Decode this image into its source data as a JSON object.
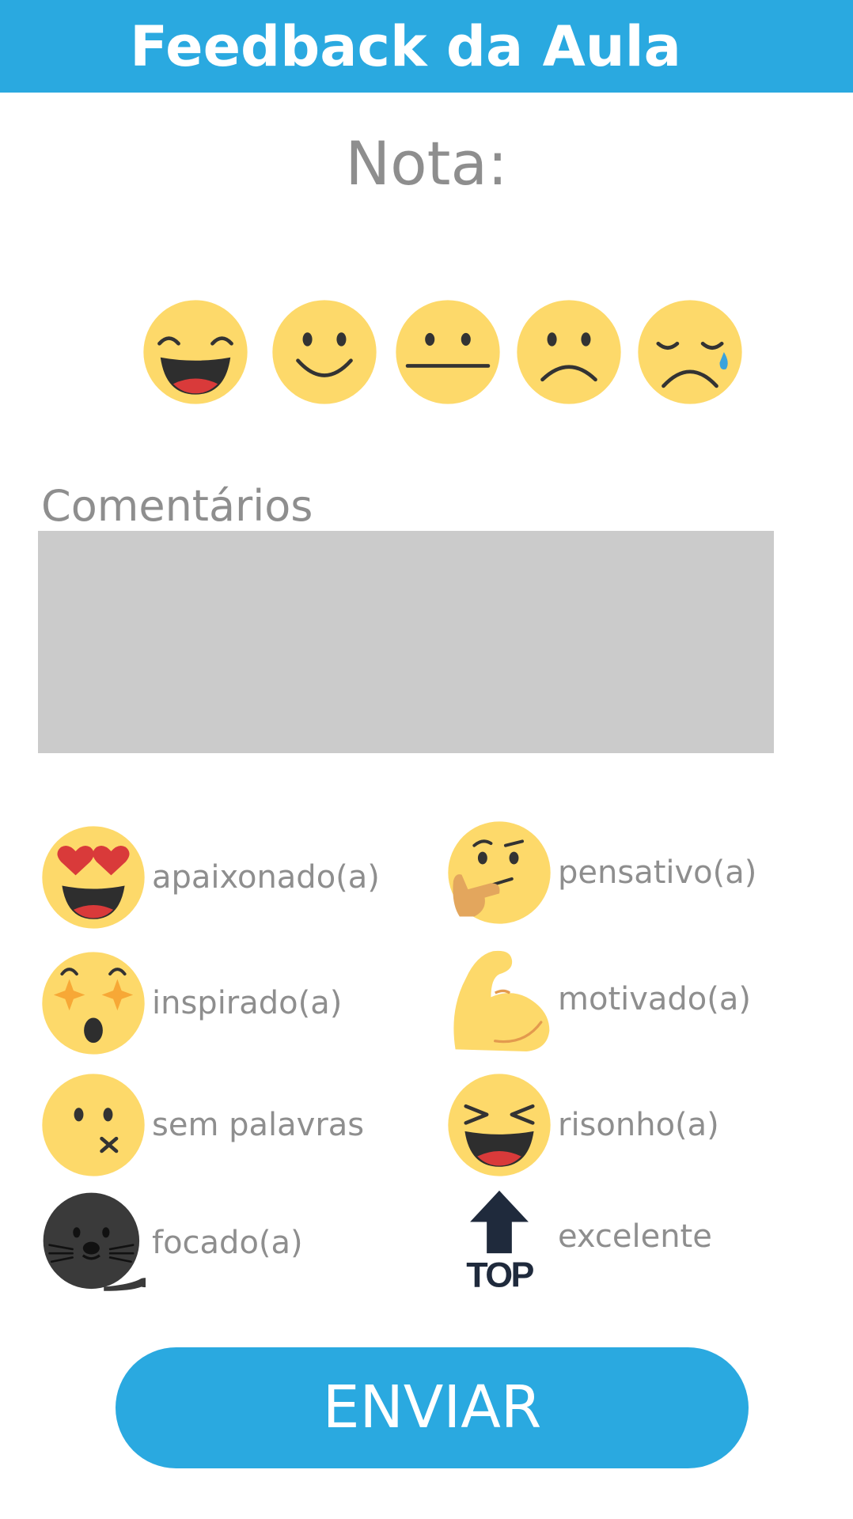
{
  "header": {
    "title": "Feedback da Aula"
  },
  "rating": {
    "label": "Nota:",
    "faces": [
      {
        "icon": "laughing-face-icon"
      },
      {
        "icon": "smiling-face-icon"
      },
      {
        "icon": "neutral-face-icon"
      },
      {
        "icon": "frowning-face-icon"
      },
      {
        "icon": "crying-face-icon"
      }
    ]
  },
  "comments": {
    "label": "Comentários",
    "value": ""
  },
  "moods": [
    {
      "icon": "heart-eyes-icon",
      "label": "apaixonado(a)"
    },
    {
      "icon": "thinking-face-icon",
      "label": "pensativo(a)"
    },
    {
      "icon": "star-struck-icon",
      "label": "inspirado(a)"
    },
    {
      "icon": "flexed-biceps-icon",
      "label": "motivado(a)"
    },
    {
      "icon": "speechless-face-icon",
      "label": "sem palavras"
    },
    {
      "icon": "squinting-laugh-icon",
      "label": "risonho(a)"
    },
    {
      "icon": "seal-icon",
      "label": "focado(a)"
    },
    {
      "icon": "top-arrow-icon",
      "label": "excelente",
      "icon_text": "TOP"
    }
  ],
  "submit": {
    "label": "ENVIAR"
  },
  "colors": {
    "header": "#2aa9e0",
    "button": "#2aa9e0",
    "face": "#fdd96a",
    "label": "#8e8e8e",
    "comment_box": "#cbcbcb"
  }
}
